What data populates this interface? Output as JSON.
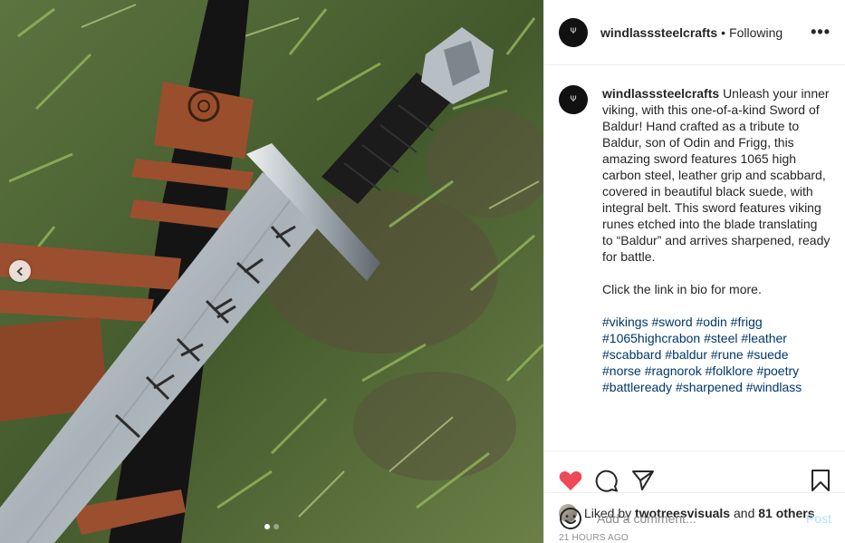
{
  "post": {
    "username": "windlasssteelcrafts",
    "following_label": "Following",
    "separator": "•",
    "more_label": "•••",
    "caption_lines": [
      "Unleash your inner viking, with this one-of-a-kind Sword of Baldur! Hand crafted as a tribute to Baldur, son of Odin and Frigg, this amazing sword features 1065 high carbon steel, leather grip and scabbard, covered in beautiful black suede, with integral belt. This sword features viking runes etched into the blade translating to “Baldur” and arrives sharpened, ready for battle.",
      "Click the link in bio for more."
    ],
    "hashtags": [
      "#vikings",
      "#sword",
      "#odin",
      "#frigg",
      "#1065highcrabon",
      "#steel",
      "#leather",
      "#scabbard",
      "#baldur",
      "#rune",
      "#suede",
      "#norse",
      "#ragnorok",
      "#folklore",
      "#poetry",
      "#battleready",
      "#sharpened",
      "#windlass"
    ],
    "liked_by_prefix": "Liked by",
    "liked_by_user": "twotreesvisuals",
    "liked_by_joiner": "and",
    "liked_by_others": "81 others",
    "timestamp": "21 HOURS AGO",
    "comment_placeholder": "Add a comment...",
    "post_label": "Post",
    "avatar_mark": "Ψ"
  },
  "carousel": {
    "slide_count": 2,
    "active_index": 0
  },
  "icons": {
    "like": "heart-filled-icon",
    "comment": "comment-bubble-icon",
    "share": "paper-plane-icon",
    "save": "bookmark-icon",
    "emoji": "emoji-smile-icon",
    "prev": "chevron-left-icon"
  },
  "colors": {
    "like_red": "#ed4956",
    "hashtag_blue": "#00376b",
    "post_disabled": "#b2dffc",
    "muted": "#8e8e8e"
  }
}
